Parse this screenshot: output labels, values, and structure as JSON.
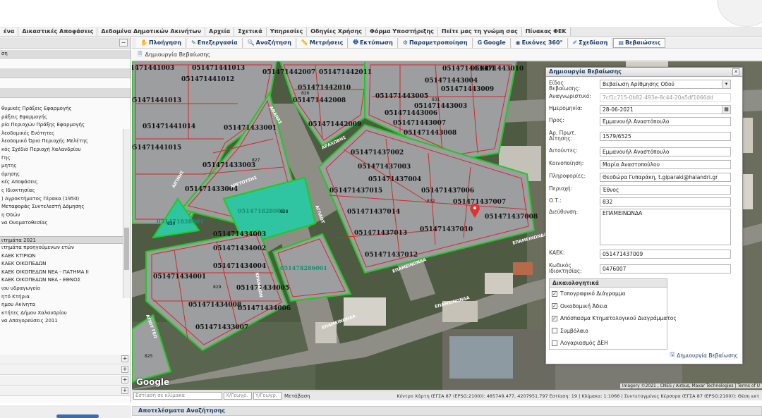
{
  "menu": [
    "ένα",
    "Δικαστικές Αποφάσεις",
    "Δεδομένα Δημοτικών Ακινήτων",
    "Αρχεία",
    "Σχετικά",
    "Υπηρεσίες",
    "Οδηγίες Χρήσης",
    "Φόρμα Υποστήριξης",
    "Πείτε μας τη γνώμη σας",
    "Πίνακας ΦΕΚ"
  ],
  "toolbar": [
    {
      "label": "Πλοήγηση",
      "icon": "hand-icon"
    },
    {
      "label": "Επεξεργασία",
      "icon": "edit-icon"
    },
    {
      "label": "Αναζήτηση",
      "icon": "search-icon"
    },
    {
      "label": "Μετρήσεις",
      "icon": "ruler-icon"
    },
    {
      "label": "Εκτύπωση",
      "icon": "print-icon"
    },
    {
      "label": "Παραμετροποίηση",
      "icon": "settings-icon"
    },
    {
      "label": "Google",
      "icon": "google-icon"
    },
    {
      "label": "Εικόνες 360°",
      "icon": "panorama-icon"
    },
    {
      "label": "Σχεδίαση",
      "icon": "draw-icon"
    },
    {
      "label": "Βεβαιώσεις",
      "icon": "certificate-icon"
    }
  ],
  "subbar": {
    "label": "Δημιουργία Βεβαίωσης"
  },
  "left_panel": {
    "section": "ση",
    "items": [
      "θυμικές Πράξεις Εφαρμογής",
      "ράξεις Εφαρμογής",
      "ρίο Περιοχών Πράξης Εφαρμογής",
      "λεοδομικές Ενότητες",
      "λεοδομικό Όριο Περιοχής Μελέτης",
      "κός Σχέδιο Περιοχή Χαλανδρίου",
      "Γης",
      "μητης",
      "όμησης",
      "κές Αποφάσεις",
      "ς Ιδιοκτησίας",
      ") Αγροκτήματος Γέρακα (1950)",
      "Μεταφοράς Συντελεστή Δόμησης",
      "η Οδών",
      "να Ονοματοθεσίας",
      "",
      "ιτημάτα 2021",
      "ιτημάτα προηγούμενων ετών",
      "ΚΑΕΚ ΚΤΙΡΙΩΝ",
      "ΚΑΕΚ ΟΙΚΟΠΕΔΩΝ",
      "ΚΑΕΚ ΟΙΚΟΠΕΔΩΝ ΝΕΑ - ΠΑΤΗΜΑ ΙΙ",
      "ΚΑΕΚ ΟΙΚΟΠΕΔΩΝ ΝΕΑ - ΕΘΝΟΣ",
      "ιου υδραγωγείο",
      "ητό Κτήρια",
      "ημου Ακίνητα",
      "κτήτες Δήμου Χαλανδρίου",
      "να Απαγορεύσεις 2011"
    ]
  },
  "dialog": {
    "title": "Δημιουργία Βεβαίωσης",
    "fields": [
      {
        "label": "Είδος Βεβαίωσης:",
        "value": "Βεβαίωση Αρίθμησης Οδού",
        "kind": "sel"
      },
      {
        "label": "Αναγνωριστικό:",
        "value": "7cf1c715-0b82-493e-8c44-20a5df1066dd",
        "kind": "ro"
      },
      {
        "label": "Ημερομηνία:",
        "value": "28-06-2021",
        "kind": "date"
      },
      {
        "label": "Προς:",
        "value": "Εμμανουήλ Αναστόπουλο",
        "kind": "text"
      },
      {
        "label": "Αρ. Πρωτ. Αίτησης:",
        "value": "1579/6525",
        "kind": "text"
      },
      {
        "label": "Αιτούντες:",
        "value": "Εμμανουήλ Αναστόπουλο",
        "kind": "text"
      },
      {
        "label": "Κοινοποίηση:",
        "value": "Μαρία Αναστοπούλου",
        "kind": "text"
      },
      {
        "label": "Πληροφορίες:",
        "value": "Θεοδώρα Γυπαράκη, t.giparaki@halandri.gr",
        "kind": "text"
      },
      {
        "label": "Περιοχή:",
        "value": "Έθνος",
        "kind": "text"
      },
      {
        "label": "Ο.Τ.:",
        "value": "832",
        "kind": "text"
      }
    ],
    "address_label": "Διεύθυνση:",
    "address_value": "ΕΠΑΜΕΙΝΩΝΔΑ",
    "kaek_label": "ΚΑΕΚ:",
    "kaek_value": "051471437009",
    "owner_label": "Κωδικός Ιδιοκτησίας:",
    "owner_value": "0476007",
    "docs_title": "Δικαιολογητικά",
    "docs": [
      {
        "label": "Τοπογραφικό Διάγραμμα",
        "checked": "✓"
      },
      {
        "label": "Οικοδομική Άδεια",
        "checked": "✓"
      },
      {
        "label": "Απόσπασμα Κτηματολογικού Διαγράμματος",
        "checked": "✓"
      },
      {
        "label": "Συμβόλαιο",
        "checked": ""
      },
      {
        "label": "Λογαριασμός ΔΕΗ",
        "checked": ""
      }
    ],
    "create_button": "Δημιουργία Βεβαίωσης"
  },
  "map": {
    "parcels": [
      {
        "label": "051471441003"
      },
      {
        "label": "051471441013"
      },
      {
        "label": "051471441012"
      },
      {
        "label": "051471441013"
      },
      {
        "label": "051471441014"
      },
      {
        "label": "051471441015"
      },
      {
        "label": "051471442007"
      },
      {
        "label": "051471442011"
      },
      {
        "label": "051471442010"
      },
      {
        "label": "051471442008"
      },
      {
        "label": "051471442009"
      },
      {
        "label": "051471443005"
      },
      {
        "label": "051471443004"
      },
      {
        "label": "051471443001"
      },
      {
        "label": "051471443006"
      },
      {
        "label": "051471443007"
      },
      {
        "label": "051471443008"
      },
      {
        "label": "051471443009"
      },
      {
        "label": "051471443010"
      },
      {
        "label": "051471443003"
      },
      {
        "label": "051471433001"
      },
      {
        "label": "051471433003"
      },
      {
        "label": "051471433004"
      },
      {
        "label": "051471437002"
      },
      {
        "label": "051471437003"
      },
      {
        "label": "051471437004"
      },
      {
        "label": "051471437015"
      },
      {
        "label": "051471437006"
      },
      {
        "label": "051471437014"
      },
      {
        "label": "051471437007"
      },
      {
        "label": "051471437008"
      },
      {
        "label": "051471437013"
      },
      {
        "label": "051471437010"
      },
      {
        "label": "051471437012"
      },
      {
        "label": "051471434003"
      },
      {
        "label": "051471434002"
      },
      {
        "label": "051471434004"
      },
      {
        "label": "051471434001"
      },
      {
        "label": "051471434005"
      },
      {
        "label": "051471434006"
      },
      {
        "label": "051471434008"
      },
      {
        "label": "051471433007"
      },
      {
        "label": "051471828001"
      },
      {
        "label": "051471828001"
      },
      {
        "label": "051478286001"
      }
    ],
    "block_numbers": [
      "826",
      "827",
      "831",
      "832",
      "829",
      "825",
      "828",
      "830"
    ],
    "streets": [
      "ΑΙΓΙΝΗΣ",
      "ΑΡΕΤΟΥΣΗΣ",
      "ΕΠΑΜΕΙΝΩΝΔΑ",
      "ΕΠΑΜΕΙΝΩΝΔΑ",
      "ΑΘΑΝΑΣ",
      "ΑΡΑΧΩΒΗΣ",
      "ΑΓΛΑΩΤ",
      "ΚΡΑΝΑΙΩΝ",
      "ΕΠΑΜΕΙΝΩΝΔΑ",
      "ΕΠΑΜΕΙΝΩΝΔΑ",
      "ΑΓΙΟΥ ΓΕΩ"
    ],
    "google": "Google",
    "attribution": "Imagery ©2021 , CNES / Airbus, Maxar Technologies | Terms of U"
  },
  "statusbar": {
    "search_placeholder": "Εστίαση σε κλίμακα",
    "x_placeholder": "Χ/Γεωγρ.",
    "y_placeholder": "Υ/Γεωγρ.",
    "goto": "Μετάβαση",
    "info": "Κέντρο Χάρτη (ΕΓΣΑ 87 (EPSG:2100)): 485749.477, 4207951.797 Εστίαση: 19 | Κλίμακα: 1:1066 | Συντεταγμένες Κέρσορα (ΕΓΣΑ 87 (EPSG:2100)): Θέση εκτ"
  },
  "results": {
    "label": "Αποτελέσματα Αναζήτησης"
  },
  "colors": {
    "parcel": "#9c9ea0",
    "parcel_border": "#d12b2b",
    "block_border": "#1ecb1e",
    "highlight": "#2fc4a2",
    "marker": "#e03030"
  }
}
